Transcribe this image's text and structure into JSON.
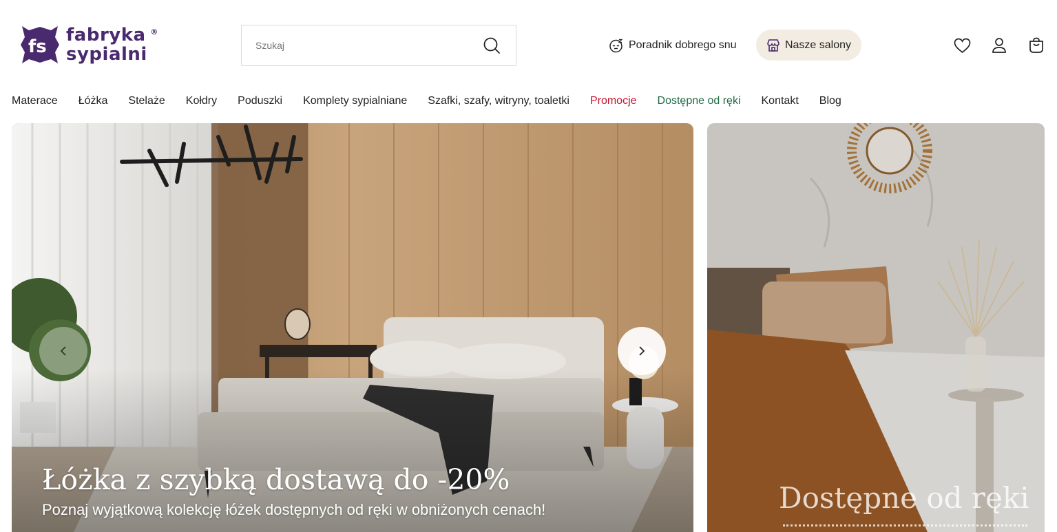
{
  "logo": {
    "line1": "fabryka",
    "line2": "sypialni",
    "mark": "fs",
    "registered": "®"
  },
  "search": {
    "placeholder": "Szukaj",
    "icon": "search-icon"
  },
  "header_links": {
    "guide": "Poradnik dobrego snu",
    "salons": "Nasze salony"
  },
  "header_icons": [
    "heart-icon",
    "user-icon",
    "shopping-bag-icon"
  ],
  "nav": {
    "items": [
      {
        "label": "Materace"
      },
      {
        "label": "Łóżka"
      },
      {
        "label": "Stelaże"
      },
      {
        "label": "Kołdry"
      },
      {
        "label": "Poduszki"
      },
      {
        "label": "Komplety sypialniane"
      },
      {
        "label": "Szafki, szafy, witryny, toaletki"
      },
      {
        "label": "Promocje"
      },
      {
        "label": "Dostępne od ręki"
      },
      {
        "label": "Kontakt"
      },
      {
        "label": "Blog"
      }
    ]
  },
  "hero": {
    "title": "Łóżka z szybką dostawą do -20%",
    "subtitle": "Poznaj wyjątkową kolekcję łóżek dostępnych od ręki w obniżonych cenach!"
  },
  "side_banner": {
    "title": "Dostępne od ręki"
  },
  "colors": {
    "brand": "#4a2a6e",
    "promo": "#c8102e",
    "available": "#1f6b45",
    "salons_bg": "#f3ece2"
  }
}
